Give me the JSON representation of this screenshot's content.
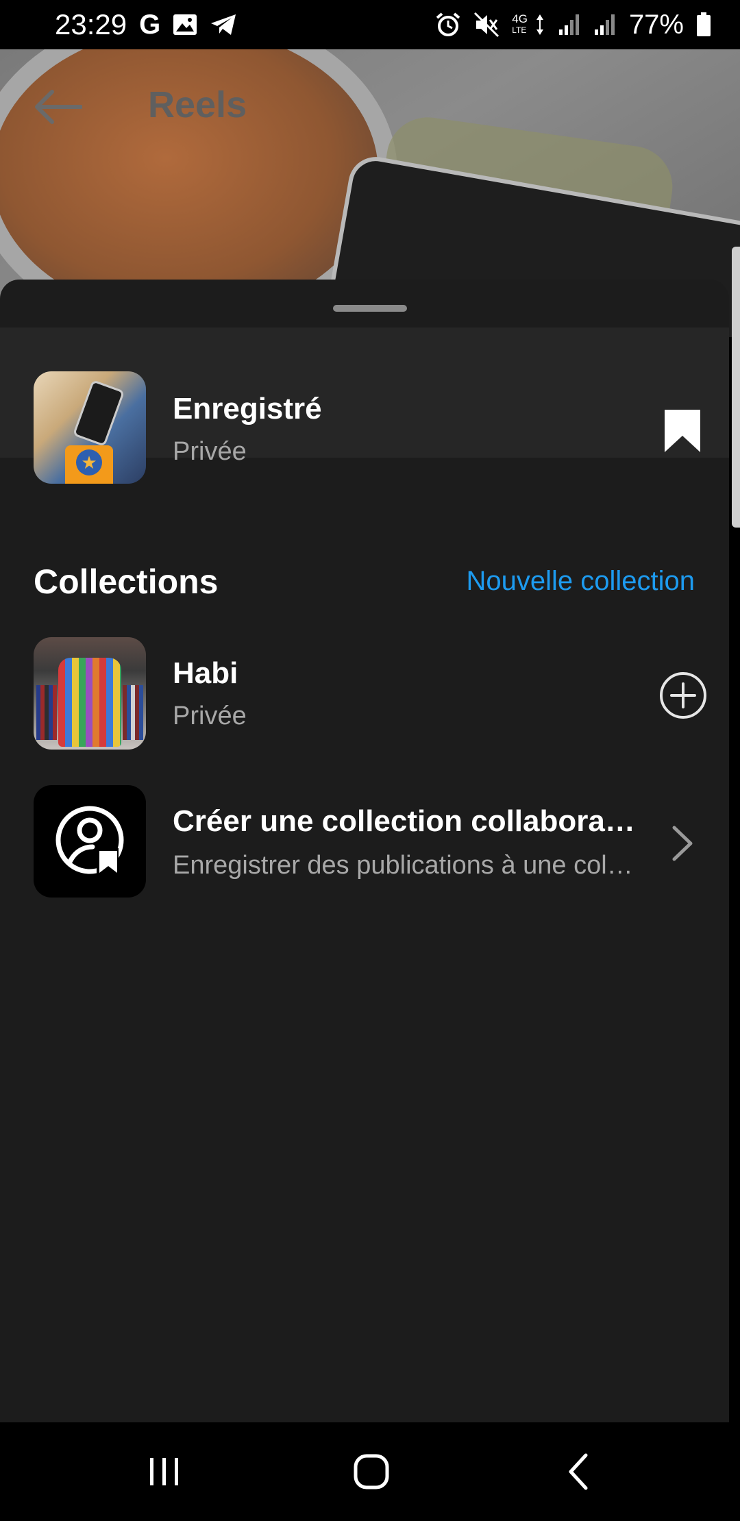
{
  "status_bar": {
    "time": "23:29",
    "g_label": "G",
    "network_top": "4G",
    "network_lte": "LTE",
    "battery_percent": "77%"
  },
  "header": {
    "title": "Reels"
  },
  "saved": {
    "title": "Enregistré",
    "subtitle": "Privée"
  },
  "collections": {
    "section_title": "Collections",
    "new_collection_label": "Nouvelle collection",
    "items": [
      {
        "title": "Habi",
        "subtitle": "Privée"
      }
    ],
    "collaborative": {
      "title": "Créer une collection collaborative",
      "subtitle": "Enregistrer des publications à une collection partagée"
    }
  },
  "colors": {
    "accent": "#1d9bf0",
    "sheet_bg": "#1c1c1c",
    "saved_row_bg": "#262626"
  }
}
